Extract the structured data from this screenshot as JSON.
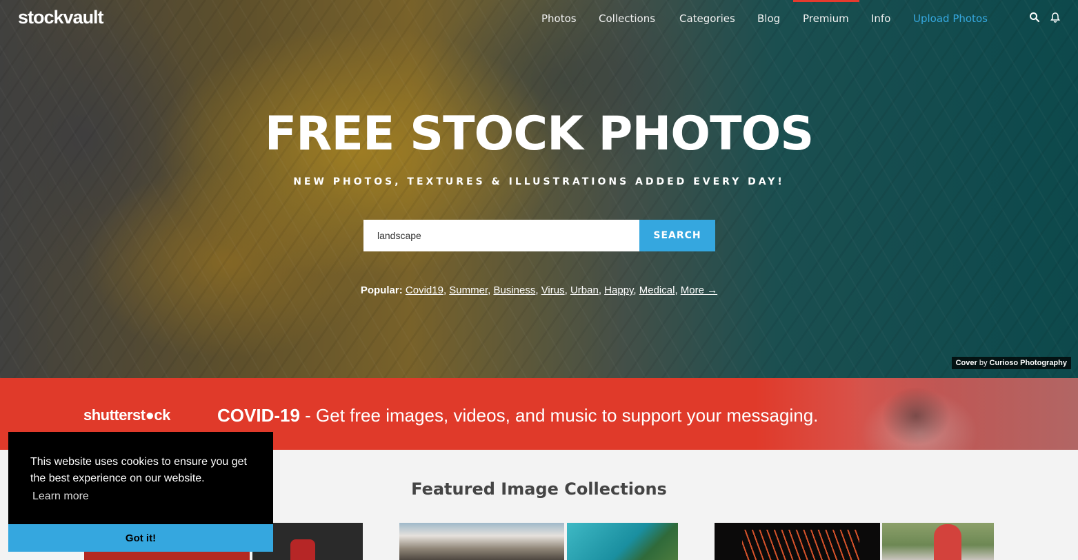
{
  "brand": {
    "logo": "stockvault"
  },
  "nav": {
    "items": [
      {
        "label": "Photos"
      },
      {
        "label": "Collections"
      },
      {
        "label": "Categories"
      },
      {
        "label": "Blog"
      },
      {
        "label": "Premium"
      },
      {
        "label": "Info"
      },
      {
        "label": "Upload Photos"
      }
    ],
    "icons": [
      "search-icon",
      "bell-icon"
    ],
    "accent_color": "#36a9e1",
    "premium_marker_color": "#e53a2e"
  },
  "hero": {
    "title": "FREE STOCK PHOTOS",
    "subtitle": "NEW PHOTOS, TEXTURES & ILLUSTRATIONS ADDED EVERY DAY!",
    "search": {
      "value": "landscape",
      "button": "SEARCH"
    },
    "popular": {
      "label": "Popular:",
      "links": [
        "Covid19",
        "Summer",
        "Business",
        "Virus",
        "Urban",
        "Happy",
        "Medical",
        "More →"
      ]
    },
    "credit": {
      "prefix": "Cover",
      "by": "by",
      "author": "Curioso Photography"
    }
  },
  "banner": {
    "logo": "shutterst●ck",
    "headline": "COVID-19",
    "separator": " - ",
    "text": "Get free images, videos, and music to support your messaging.",
    "color": "#e03a2a"
  },
  "featured": {
    "title": "Featured Image Collections"
  },
  "cookie": {
    "message": "This website uses cookies to ensure you get the best experience on our website.",
    "learn_more": "Learn more",
    "button": "Got it!",
    "button_color": "#35a7df"
  }
}
